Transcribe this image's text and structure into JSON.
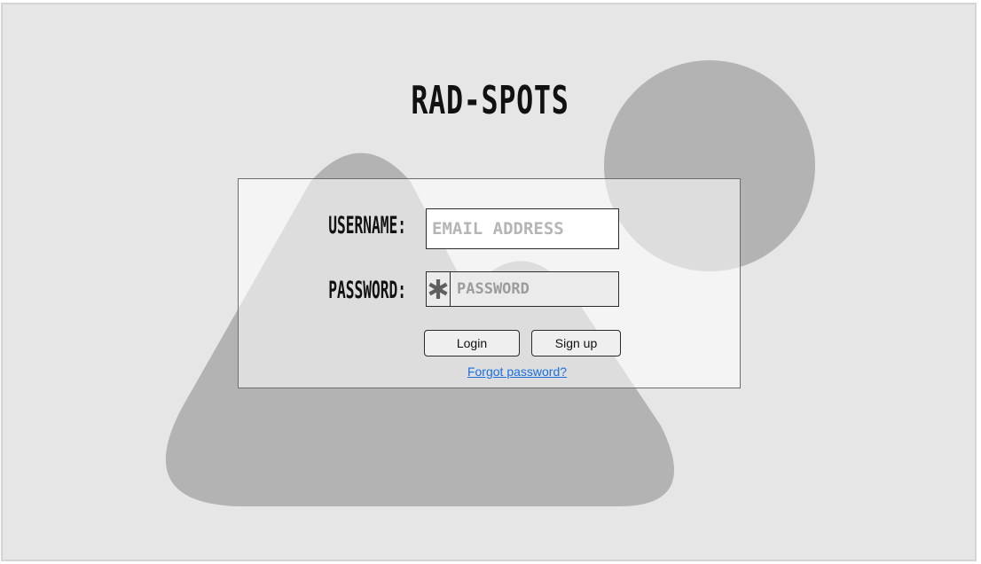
{
  "app": {
    "title": "RAD-SPOTS"
  },
  "login_form": {
    "username_label": "USERNAME:",
    "password_label": "PASSWORD:",
    "email_input": {
      "value": "",
      "placeholder": "EMAIL ADDRESS"
    },
    "password_input": {
      "value": "",
      "placeholder": "PASSWORD",
      "icon": "asterisk-icon"
    },
    "login_button": "Login",
    "signup_button": "Sign up",
    "forgot_link": "Forgot password?"
  },
  "colors": {
    "background": "#e6e6e6",
    "shape": "#b3b3b3",
    "panel_border": "#6d6d6d",
    "link": "#1a6fe0"
  }
}
